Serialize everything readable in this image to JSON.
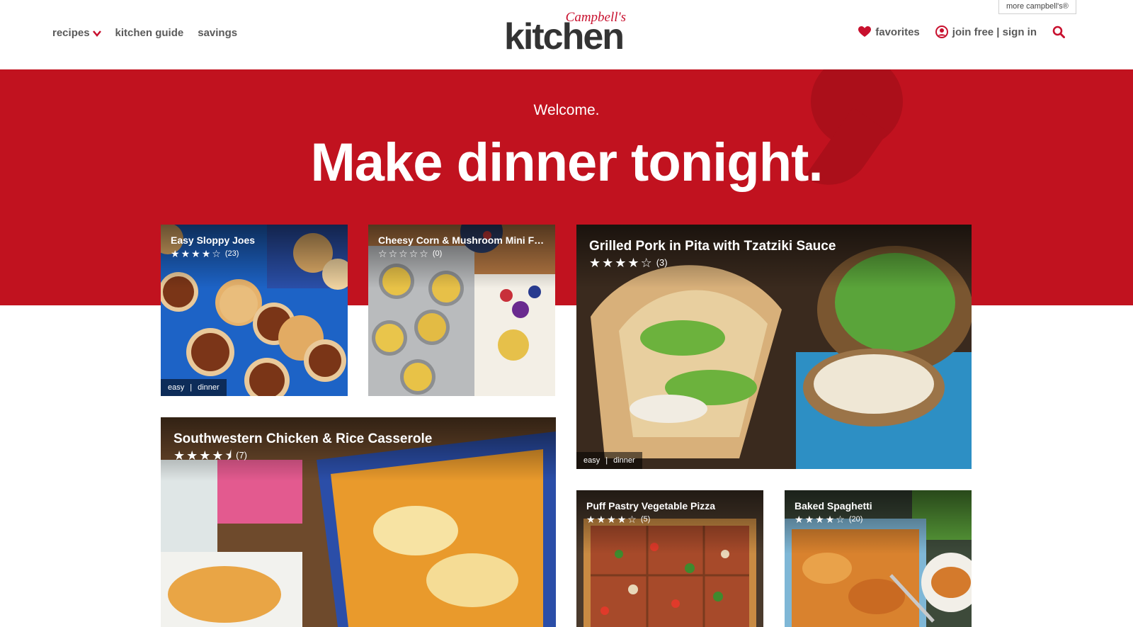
{
  "header": {
    "more_brands": "more campbell's®",
    "nav_left": [
      {
        "label": "recipes",
        "has_dropdown": true
      },
      {
        "label": "kitchen guide"
      },
      {
        "label": "savings"
      }
    ],
    "logo": {
      "script": "Campbell's",
      "word": "kitchen"
    },
    "favorites": "favorites",
    "account": "join free | sign in",
    "brand_color": "#c8102e"
  },
  "hero": {
    "welcome": "Welcome.",
    "headline": "Make dinner tonight.",
    "background": "#c1121f"
  },
  "recipes": [
    {
      "title": "Easy Sloppy Joes",
      "stars": 4,
      "rating_count": "(23)",
      "tags": [
        "easy",
        "dinner"
      ]
    },
    {
      "title": "Cheesy Corn & Mushroom Mini Fritt...",
      "stars": 0,
      "rating_count": "(0)",
      "tags": []
    },
    {
      "title": "Grilled Pork in Pita with Tzatziki Sauce",
      "stars": 4,
      "rating_count": "(3)",
      "tags": [
        "easy",
        "dinner"
      ]
    },
    {
      "title": "Southwestern Chicken & Rice Casserole",
      "stars": 4.5,
      "rating_count": "(7)",
      "tags": []
    },
    {
      "title": "Puff Pastry Vegetable Pizza",
      "stars": 4,
      "rating_count": "(5)",
      "tags": []
    },
    {
      "title": "Baked Spaghetti",
      "stars": 4,
      "rating_count": "(20)",
      "tags": []
    }
  ]
}
